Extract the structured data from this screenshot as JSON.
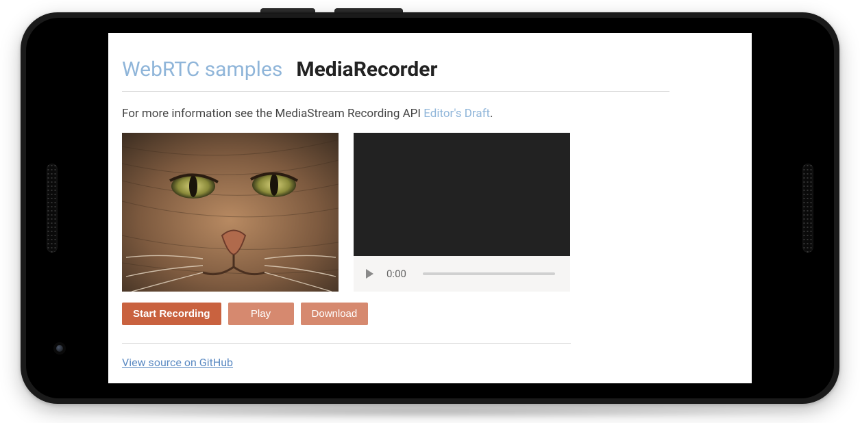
{
  "header": {
    "title_link": "WebRTC samples",
    "title_page": "MediaRecorder"
  },
  "info": {
    "prefix": "For more information see the MediaStream Recording API ",
    "link_text": "Editor's Draft",
    "suffix": "."
  },
  "player": {
    "current_time": "0:00"
  },
  "buttons": {
    "start": "Start Recording",
    "play": "Play",
    "download": "Download"
  },
  "footer": {
    "source_link": "View source on GitHub"
  },
  "icons": {
    "play": "play-icon"
  }
}
